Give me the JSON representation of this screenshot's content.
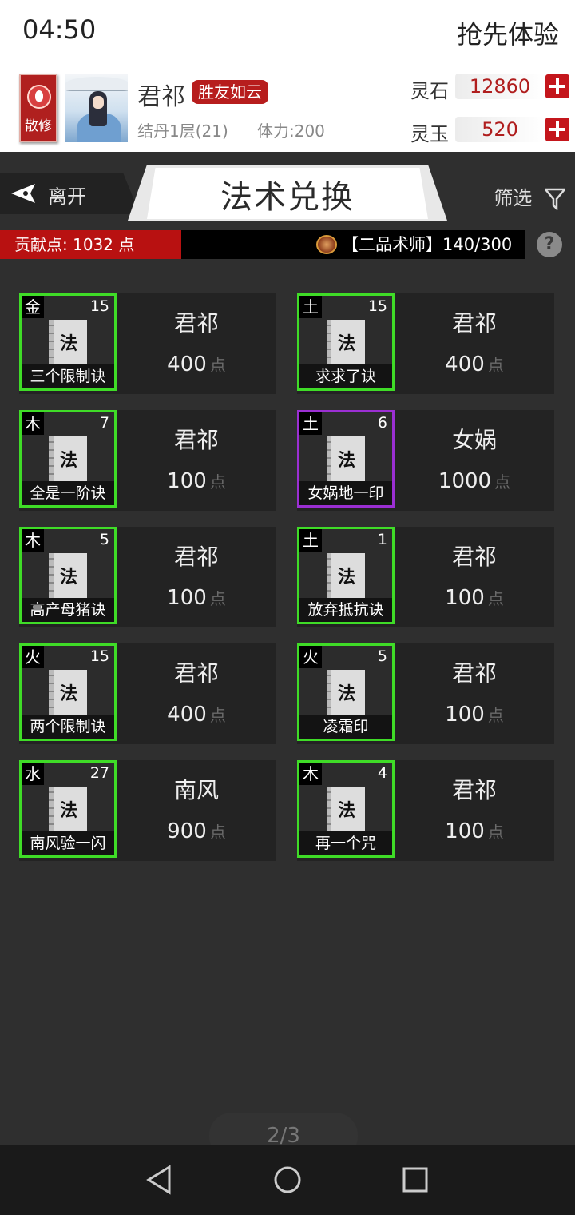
{
  "status": {
    "time": "04:50",
    "early_access": "抢先体验"
  },
  "profile": {
    "sect_label": "散修",
    "name": "君祁",
    "title": "胜友如云",
    "realm": "结丹1层(21)",
    "stamina": "体力:200",
    "currencies": [
      {
        "label": "灵石",
        "value": "12860"
      },
      {
        "label": "灵玉",
        "value": "520"
      }
    ]
  },
  "titlebar": {
    "leave_label": "离开",
    "title": "法术兑换",
    "filter_label": "筛选"
  },
  "contrib": {
    "points": "贡献点: 1032 点",
    "rank": "【二品术师】140/300",
    "help": "?"
  },
  "spells": [
    {
      "element": "金",
      "level": "15",
      "icon_glyph": "法",
      "name": "三个限制诀",
      "owner": "君祁",
      "price": "400",
      "unit": "点",
      "rarity": "green"
    },
    {
      "element": "土",
      "level": "15",
      "icon_glyph": "法",
      "name": "求求了诀",
      "owner": "君祁",
      "price": "400",
      "unit": "点",
      "rarity": "green"
    },
    {
      "element": "木",
      "level": "7",
      "icon_glyph": "法",
      "name": "全是一阶诀",
      "owner": "君祁",
      "price": "100",
      "unit": "点",
      "rarity": "green"
    },
    {
      "element": "土",
      "level": "6",
      "icon_glyph": "法",
      "name": "女娲地一印",
      "owner": "女娲",
      "price": "1000",
      "unit": "点",
      "rarity": "purple"
    },
    {
      "element": "木",
      "level": "5",
      "icon_glyph": "法",
      "name": "高产母猪诀",
      "owner": "君祁",
      "price": "100",
      "unit": "点",
      "rarity": "green"
    },
    {
      "element": "土",
      "level": "1",
      "icon_glyph": "法",
      "name": "放弃抵抗诀",
      "owner": "君祁",
      "price": "100",
      "unit": "点",
      "rarity": "green"
    },
    {
      "element": "火",
      "level": "15",
      "icon_glyph": "法",
      "name": "两个限制诀",
      "owner": "君祁",
      "price": "400",
      "unit": "点",
      "rarity": "green"
    },
    {
      "element": "火",
      "level": "5",
      "icon_glyph": "法",
      "name": "凌霜印",
      "owner": "君祁",
      "price": "100",
      "unit": "点",
      "rarity": "green"
    },
    {
      "element": "水",
      "level": "27",
      "icon_glyph": "法",
      "name": "南风验一闪",
      "owner": "南风",
      "price": "900",
      "unit": "点",
      "rarity": "green"
    },
    {
      "element": "木",
      "level": "4",
      "icon_glyph": "法",
      "name": "再一个咒",
      "owner": "君祁",
      "price": "100",
      "unit": "点",
      "rarity": "green"
    }
  ],
  "pagination": {
    "label": "2/3"
  },
  "colors": {
    "accent_red": "#b81111",
    "green_border": "#3fdc27",
    "purple_border": "#9b2fd3"
  }
}
